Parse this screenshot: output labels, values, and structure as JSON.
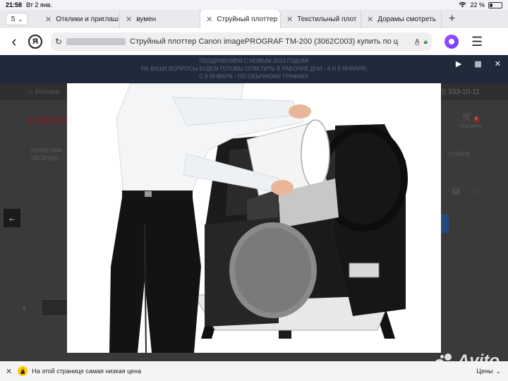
{
  "status": {
    "time": "21:58",
    "date": "Вт 2 янв.",
    "battery": "22 %",
    "battery_level": 0.22
  },
  "tabs": {
    "count": "5",
    "items": [
      {
        "label": "Отклики и приглаш",
        "active": false
      },
      {
        "label": "вумен",
        "active": false
      },
      {
        "label": "Струйный плоттер",
        "active": true
      },
      {
        "label": "Текстильный плот",
        "active": false
      },
      {
        "label": "Дорамы смотреть",
        "active": false
      }
    ]
  },
  "address": {
    "url_title": "Струйный плоттер Canon imagePROGRAF TM-200 (3062C003) купить по ц"
  },
  "page": {
    "banner_lines": [
      "ПОЗДРАВЛЯЕМ С НОВЫМ 2024 ГОДОМ!",
      "НА ВАШИ ВОПРОСЫ БУДЕМ ГОТОВЫ ОТВЕТИТЬ В РАБОЧИЕ ДНИ - 4 И 5 ЯНВАРЯ,",
      "С 9 ЯНВАРЯ - ПО ОБЫЧНОМУ ГРАФИКУ."
    ],
    "city": "Москва",
    "phone": "0) 333-10-11",
    "logo": "FOROF",
    "cart_label": "Корзина",
    "cart_count": "0",
    "menu_left_1": "ПОЛИГРАФ",
    "menu_left_2": "ОБОРУДО",
    "menu_right": "УСЛУГИ"
  },
  "bottom": {
    "message": "На этой странице самая низкая цена",
    "prices_label": "Цены"
  },
  "watermark": "Avito"
}
